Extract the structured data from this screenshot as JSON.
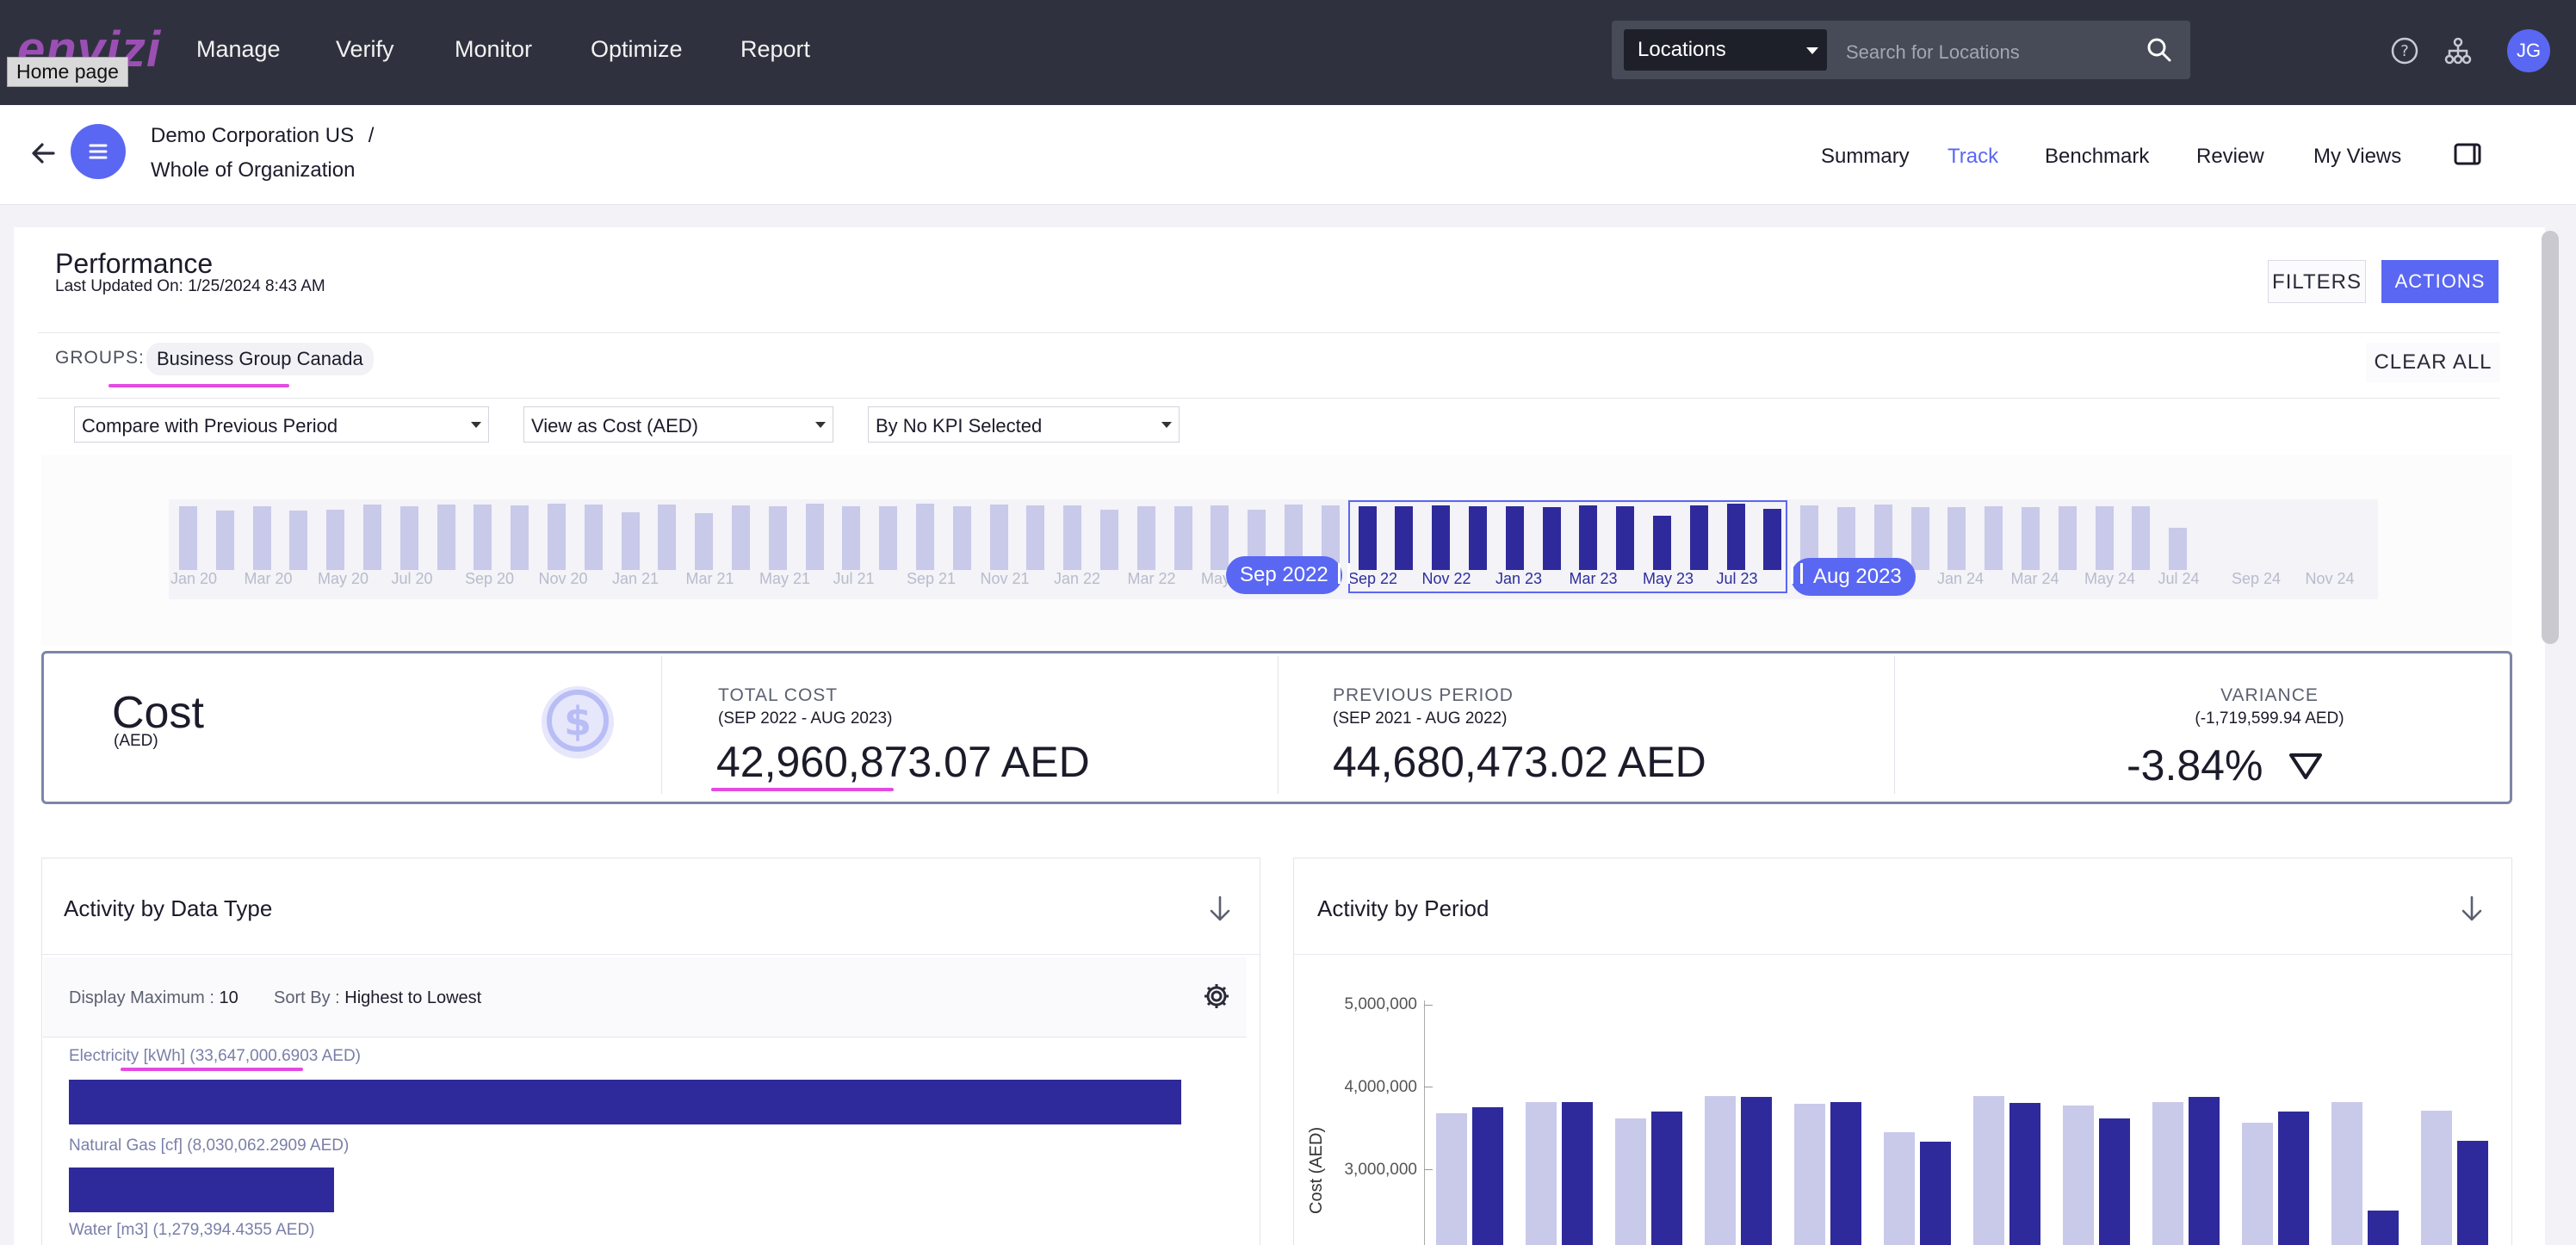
{
  "top_nav": {
    "logo": "envizi",
    "home_tooltip": "Home page",
    "items": [
      "Manage",
      "Verify",
      "Monitor",
      "Optimize",
      "Report"
    ],
    "location_selector": "Locations",
    "search_placeholder": "Search for Locations",
    "avatar_initials": "JG",
    "icons": [
      "help-icon",
      "hierarchy-icon",
      "search-icon"
    ]
  },
  "header": {
    "breadcrumb_org": "Demo Corporation US",
    "breadcrumb_sep": "/",
    "breadcrumb_scope": "Whole of Organization",
    "tabs": [
      "Summary",
      "Track",
      "Benchmark",
      "Review",
      "My Views"
    ],
    "active_tab": "Track"
  },
  "performance": {
    "title": "Performance",
    "last_updated": "Last Updated On: 1/25/2024 8:43 AM",
    "filters_label": "FILTERS",
    "actions_label": "ACTIONS",
    "groups_label": "GROUPS:",
    "group_chip": "Business Group Canada",
    "clear_all_label": "CLEAR ALL",
    "compare_select": "Compare with Previous Period",
    "view_select": "View as Cost (AED)",
    "kpi_select": "By No KPI Selected"
  },
  "timeline": {
    "labels": [
      "Jan 20",
      "Mar 20",
      "May 20",
      "Jul 20",
      "Sep 20",
      "Nov 20",
      "Jan 21",
      "Mar 21",
      "May 21",
      "Jul 21",
      "Sep 21",
      "Nov 21",
      "Jan 22",
      "Mar 22",
      "May 22",
      "Jul 22",
      "Sep 22",
      "Nov 22",
      "Jan 23",
      "Mar 23",
      "May 23",
      "Jul 23",
      "Sep 23",
      "Nov 23",
      "Jan 24",
      "Mar 24",
      "May 24",
      "Jul 24",
      "Sep 24",
      "Nov 24"
    ],
    "bar_levels": [
      0.93,
      0.86,
      0.92,
      0.86,
      0.87,
      0.95,
      0.93,
      0.95,
      0.95,
      0.94,
      0.96,
      0.95,
      0.84,
      0.95,
      0.82,
      0.94,
      0.92,
      0.96,
      0.93,
      0.93,
      0.96,
      0.92,
      0.95,
      0.94,
      0.94,
      0.88,
      0.93,
      0.92,
      0.94,
      0.88,
      0.95,
      0.94,
      0.92,
      0.93,
      0.94,
      0.93,
      0.93,
      0.91,
      0.94,
      0.93,
      0.79,
      0.94,
      0.96,
      0.89,
      0.94,
      0.91,
      0.95,
      0.91,
      0.91,
      0.93,
      0.91,
      0.92,
      0.93,
      0.93,
      0.61,
      0.87,
      0.93,
      0.94,
      0.86,
      0.93,
      0.91,
      0.91,
      0.93,
      0.92,
      0.91,
      0.93,
      0.88,
      0.55,
      0.84,
      0.86,
      0.88,
      0.84,
      0.86,
      0.85,
      0.87,
      0.84
    ],
    "start_label": "Sep 2022",
    "end_label": "Aug 2023",
    "selected_from": 32,
    "selected_to": 43
  },
  "kpi": {
    "metric": "Cost",
    "metric_unit": "(AED)",
    "total_label": "TOTAL COST",
    "total_period": "(SEP 2022 - AUG 2023)",
    "total_value": "42,960,873.07 AED",
    "prev_label": "PREVIOUS PERIOD",
    "prev_period": "(SEP 2021 - AUG 2022)",
    "prev_value": "44,680,473.02 AED",
    "variance_label": "VARIANCE",
    "variance_abs": "(-1,719,599.94 AED)",
    "variance_pct": "-3.84%",
    "icon": "dollar-coin-icon"
  },
  "activity_by_type": {
    "title": "Activity by Data Type",
    "display_max_label": "Display Maximum :",
    "display_max_value": "10",
    "sort_label": "Sort By :",
    "sort_value": "Highest to Lowest",
    "items": [
      {
        "label": "Electricity [kWh] (33,647,000.6903 AED)",
        "value": 33647000.6903
      },
      {
        "label": "Natural Gas [cf] (8,030,062.2909 AED)",
        "value": 8030062.2909
      },
      {
        "label": "Water [m3] (1,279,394.4355 AED)",
        "value": 1279394.4355
      }
    ]
  },
  "activity_by_period": {
    "title": "Activity by Period",
    "y_ticks": [
      "5,000,000",
      "4,000,000",
      "3,000,000"
    ],
    "y_title": "Cost (AED)"
  },
  "chart_data": {
    "type": "bar",
    "title": "Activity by Period",
    "ylabel": "Cost (AED)",
    "ylim": [
      2000000,
      5000000
    ],
    "series": [
      {
        "values": [
          3680000,
          3820000,
          3620000,
          3890000,
          3800000,
          3450000,
          3890000,
          3780000,
          3820000,
          3570000,
          3820000,
          3710000
        ]
      },
      {
        "values": [
          3750000,
          3820000,
          3700000,
          3880000,
          3820000,
          3330000,
          3810000,
          3620000,
          3880000,
          3700000,
          2500000,
          3350000
        ]
      }
    ],
    "colors": [
      "#c9c9ea",
      "#2f2a9b"
    ]
  },
  "colors": {
    "accent": "#5a67f2",
    "bar_dark": "#2f2a9b",
    "bar_light": "#c9c9ea",
    "nav_bg": "#2f323e",
    "highlight": "#e44ae2"
  }
}
